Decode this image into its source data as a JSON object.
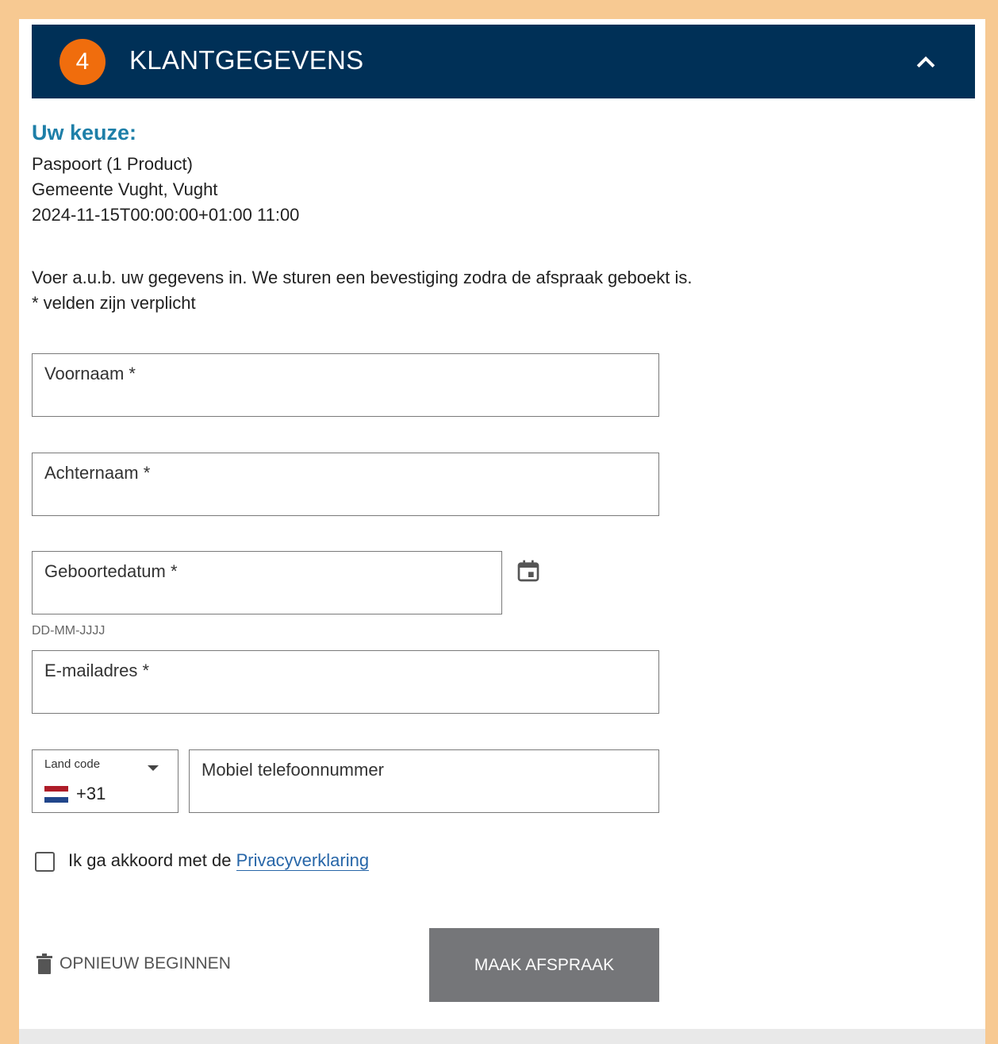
{
  "header": {
    "step_number": "4",
    "title": "KLANTGEGEVENS",
    "collapse_icon": "chevron-up-icon"
  },
  "choice": {
    "title": "Uw keuze:",
    "product": "Paspoort (1 Product)",
    "location": "Gemeente Vught, Vught",
    "datetime": "2024-11-15T00:00:00+01:00 11:00"
  },
  "intro": {
    "text": "Voer a.u.b. uw gegevens in. We sturen een bevestiging zodra de afspraak geboekt is.",
    "required_note": "* velden zijn verplicht"
  },
  "form": {
    "first_name": {
      "label": "Voornaam *",
      "value": ""
    },
    "last_name": {
      "label": "Achternaam *",
      "value": ""
    },
    "birth_date": {
      "label": "Geboortedatum *",
      "value": "",
      "hint": "DD-MM-JJJJ"
    },
    "email": {
      "label": "E-mailadres *",
      "value": ""
    },
    "country_code": {
      "label": "Land code",
      "value": "+31",
      "flag": "NL"
    },
    "phone": {
      "label": "Mobiel telefoonnummer",
      "value": ""
    }
  },
  "consent": {
    "checked": false,
    "text": "Ik ga akkoord met de ",
    "link_text": "Privacyverklaring"
  },
  "actions": {
    "restart_label": "OPNIEUW BEGINNEN",
    "submit_label": "MAAK AFSPRAAK"
  },
  "colors": {
    "header_bg": "#003057",
    "badge": "#f06d0d",
    "accent_title": "#1e7fa8",
    "link": "#2766a8",
    "submit_bg": "#757679",
    "outer_frame": "#f7c992"
  }
}
